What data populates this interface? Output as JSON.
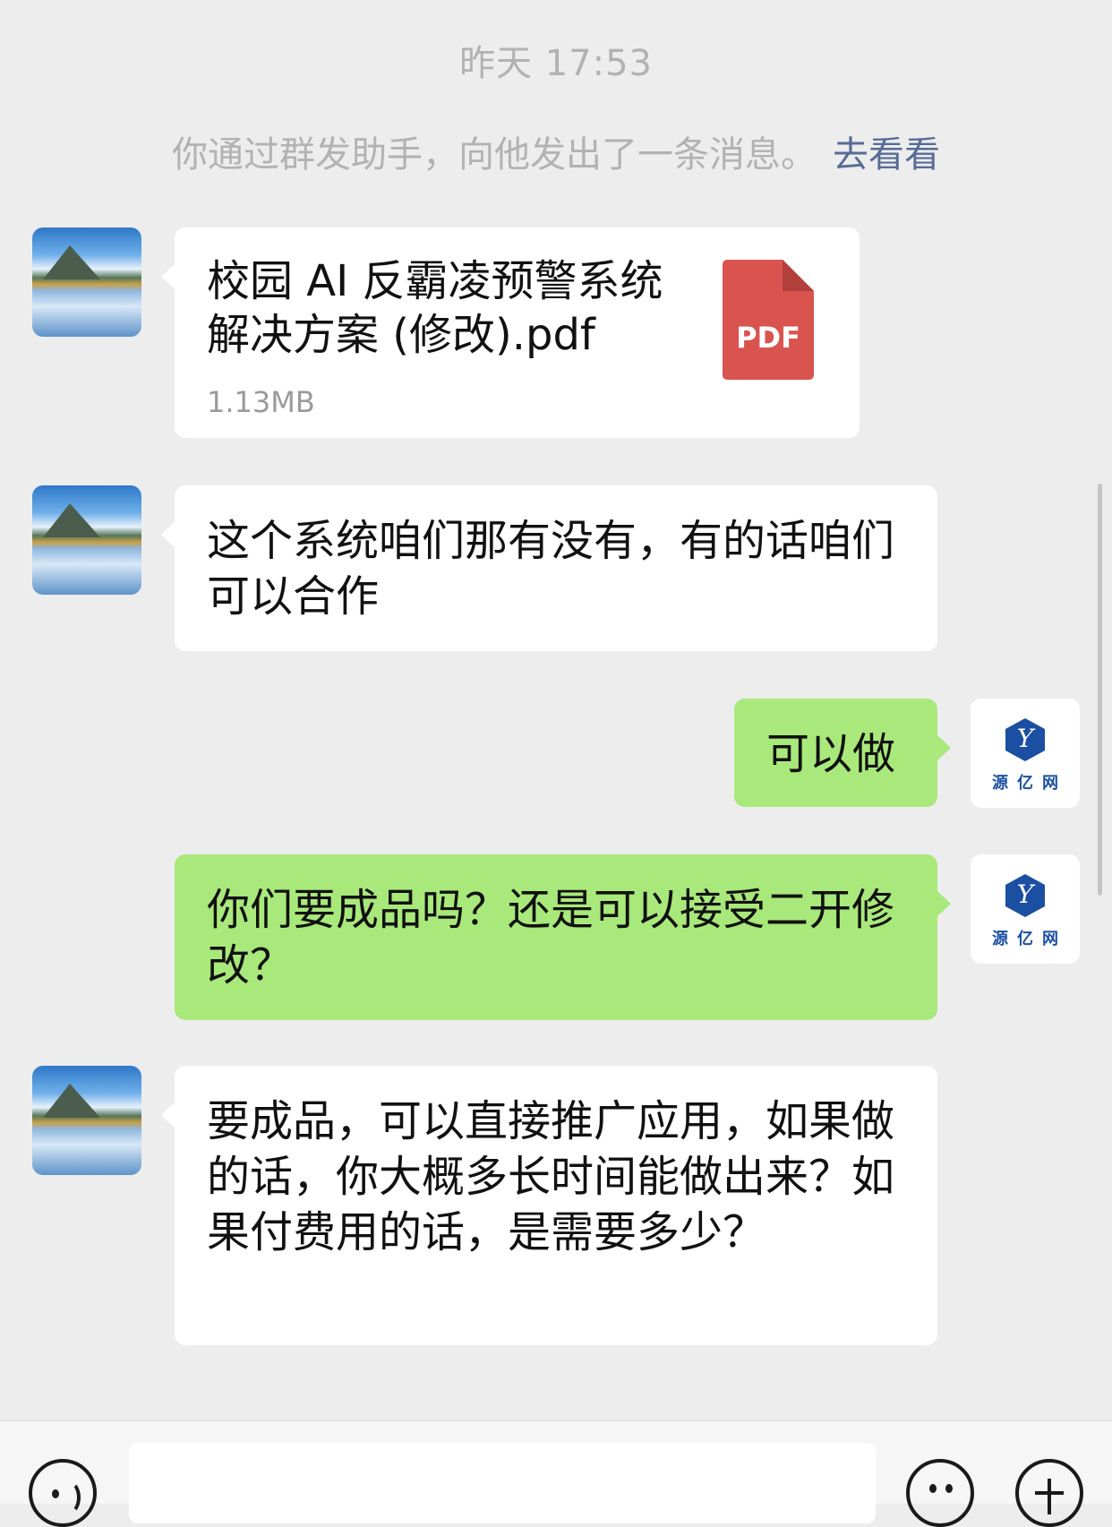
{
  "chat": {
    "timestamp": "昨天 17:53",
    "system_notice": "你通过群发助手，向他发出了一条消息。",
    "system_link": "去看看"
  },
  "messages": [
    {
      "side": "in",
      "type": "file",
      "file_name": "校园 AI 反霸凌预警系统解决方案 (修改).pdf",
      "file_size": "1.13MB",
      "file_icon_label": "PDF"
    },
    {
      "side": "in",
      "type": "text",
      "text": "这个系统咱们那有没有，有的话咱们可以合作"
    },
    {
      "side": "out",
      "type": "text",
      "text": "可以做"
    },
    {
      "side": "out",
      "type": "text",
      "text": "你们要成品吗？还是可以接受二开修改？"
    },
    {
      "side": "in",
      "type": "text",
      "text": "要成品，可以直接推广应用，如果做的话，你大概多长时间能做出来？如果付费用的话，是需要多少？"
    }
  ],
  "brand_avatar": {
    "mark": "Y",
    "name": "源亿网",
    "color": "#1b4fa1"
  },
  "colors": {
    "background": "#ededed",
    "outgoing_bubble": "#a9e97b",
    "incoming_bubble": "#ffffff",
    "link": "#576b95",
    "pdf": "#d9534f"
  },
  "input_bar": {
    "icons": [
      "voice-icon",
      "emoji-icon",
      "plus-icon"
    ]
  }
}
